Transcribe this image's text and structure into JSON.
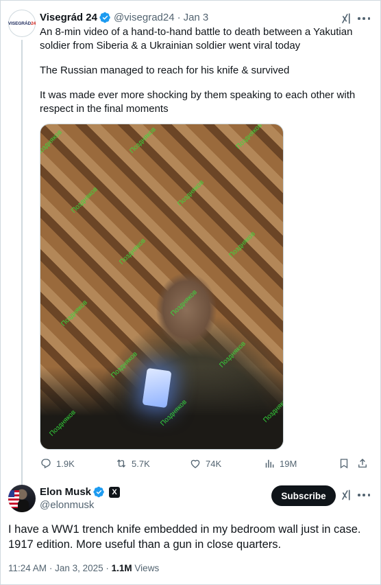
{
  "quoted_tweet": {
    "author_name": "Visegrád 24",
    "handle": "@visegrad24",
    "date": "Jan 3",
    "avatar_text_dark": "VISEGRÁD",
    "avatar_text_red": "24",
    "paragraphs": [
      "An 8-min video of a hand-to-hand battle to death between a Yakutian soldier from Siberia & a Ukrainian soldier went viral today",
      "The Russian managed to reach for his knife & survived",
      "It was made ever more shocking by them speaking to each other with respect in the final moments"
    ],
    "image_watermark": "Поздняков",
    "stats": {
      "replies": "1.9K",
      "reposts": "5.7K",
      "likes": "74K",
      "views": "19M"
    }
  },
  "main_tweet": {
    "author_name": "Elon Musk",
    "handle": "@elonmusk",
    "subscribe_label": "Subscribe",
    "affiliation_badge": "X",
    "text": "I have a WW1 trench knife embedded in my bedroom wall just in case. 1917 edition. More useful than a gun in close quarters.",
    "time": "11:24 AM",
    "date": "Jan 3, 2025",
    "views_count": "1.1M",
    "views_label": "Views"
  },
  "colors": {
    "text_primary": "#0f1419",
    "text_secondary": "#536471",
    "verified_blue": "#1d9bf0",
    "watermark_green": "#35e33d",
    "border": "#cfd9de"
  },
  "icons": [
    "verified-badge-icon",
    "grok-icon",
    "more-icon",
    "reply-icon",
    "repost-icon",
    "like-icon",
    "views-icon",
    "bookmark-icon",
    "share-icon",
    "x-affiliation-icon"
  ]
}
